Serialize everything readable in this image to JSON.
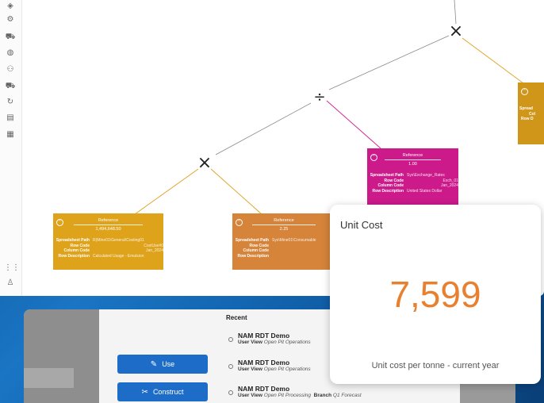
{
  "toolbar": {
    "icons": [
      "layers-icon",
      "gear-icon",
      "truck-icon",
      "globe-icon",
      "people-icon",
      "truck-icon",
      "refresh-icon",
      "calculator-icon",
      "calendar-icon"
    ],
    "bottom_icons": [
      "grid-icon",
      "user-icon"
    ]
  },
  "tree": {
    "operators": [
      "×",
      "÷",
      "×"
    ],
    "colors": {
      "orange_line": "#e0a020",
      "magenta_line": "#d21f8e",
      "gray_line": "#8a8a8a"
    }
  },
  "cards": [
    {
      "header": "Reference",
      "value": "1,494,648.50",
      "color": "#dea21b",
      "rows": [
        {
          "k": "Spreadsheet Path",
          "v": "R(Mine01\\General\\Costing01"
        },
        {
          "k": "Row Code",
          "v": "CostUse#0"
        },
        {
          "k": "Column Code",
          "v": "Jan_2024"
        },
        {
          "k": "Row Description",
          "v": "Calculated Usage - Emulsion"
        }
      ]
    },
    {
      "header": "Reference",
      "value": "2.25",
      "color": "#d5843a",
      "rows": [
        {
          "k": "Spreadsheet Path",
          "v": "Sys\\Mine01\\Consumable"
        },
        {
          "k": "Row Code",
          "v": ""
        },
        {
          "k": "Column Code",
          "v": ""
        },
        {
          "k": "Row Description",
          "v": ""
        }
      ]
    },
    {
      "header": "Reference",
      "value": "1.00",
      "color": "#cc1a8a",
      "rows": [
        {
          "k": "Spreadsheet Path",
          "v": "Sys\\Exchange_Rates"
        },
        {
          "k": "Row Code",
          "v": "Exch_01"
        },
        {
          "k": "Column Code",
          "v": "Jan_2024"
        },
        {
          "k": "Row Description",
          "v": "United States Dollar"
        }
      ]
    },
    {
      "header": "",
      "value": "",
      "color": "#d0961a",
      "rows": [
        {
          "k": "Spread",
          "v": ""
        },
        {
          "k": "Col",
          "v": ""
        },
        {
          "k": "Row D",
          "v": ""
        }
      ]
    }
  ],
  "launcher": {
    "use_label": "Use",
    "construct_label": "Construct",
    "recent_title": "Recent",
    "recent": [
      {
        "name": "NAM RDT Demo",
        "view_label": "User View",
        "view": "Open Pit Operations",
        "branch_label": "",
        "branch": ""
      },
      {
        "name": "NAM RDT Demo",
        "view_label": "User View",
        "view": "Open Pit Operations",
        "branch_label": "",
        "branch": ""
      },
      {
        "name": "NAM RDT Demo",
        "view_label": "User View",
        "view": "Open Pit Processing",
        "branch_label": "Branch",
        "branch": "Q1 Forecast"
      }
    ]
  },
  "kpi": {
    "title": "Unit Cost",
    "value": "7,599",
    "caption": "Unit cost per tonne - current year",
    "value_color": "#e8802f"
  }
}
